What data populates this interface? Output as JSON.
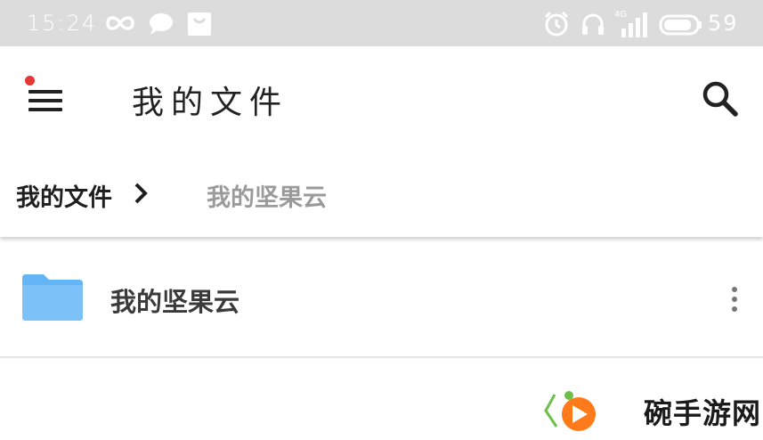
{
  "status_bar": {
    "time": "15:24",
    "network": "4G",
    "battery": "59",
    "icons": [
      "infinity-icon",
      "chat-bubble-icon",
      "bag-icon",
      "alarm-icon",
      "headphones-icon",
      "signal-icon",
      "battery-icon"
    ]
  },
  "app_bar": {
    "title": "我的文件",
    "menu_icon": "hamburger-menu-icon",
    "search_icon": "search-icon",
    "notification_dot_color": "#e53935"
  },
  "breadcrumb": {
    "root": "我的文件",
    "current": "我的坚果云"
  },
  "files": [
    {
      "name": "我的坚果云",
      "icon": "folder-icon",
      "icon_color": "#64b5f6"
    }
  ],
  "watermark": {
    "text": "碗手游网"
  },
  "colors": {
    "status_bar_bg": "#dcdcdc",
    "folder": "#64b5f6",
    "watermark_orange": "#ff7a1a",
    "watermark_green": "#6cc04a"
  }
}
